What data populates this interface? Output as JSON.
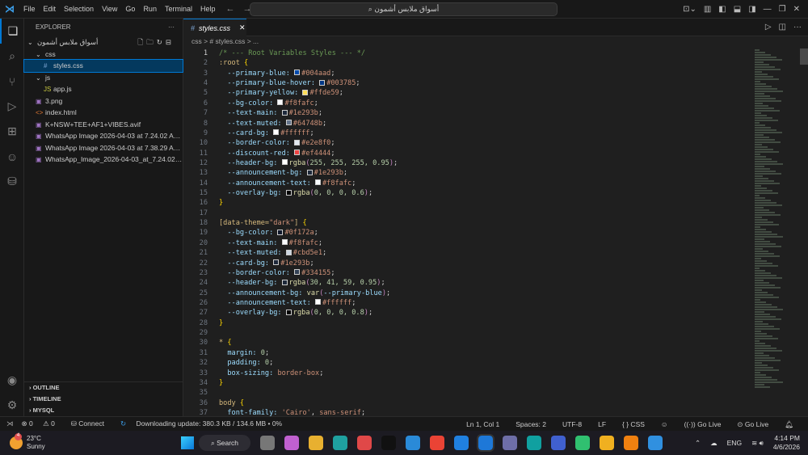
{
  "menu": [
    "File",
    "Edit",
    "Selection",
    "View",
    "Go",
    "Run",
    "Terminal",
    "Help"
  ],
  "search_text": "أسواق ملابس أشمون",
  "explorer": {
    "title": "EXPLORER",
    "root": "أسواق ملابس أشمون",
    "items": [
      {
        "label": "css",
        "icon": "⌄",
        "indent": 1,
        "sel": false
      },
      {
        "label": "styles.css",
        "icon": "#",
        "indent": 2,
        "sel": true
      },
      {
        "label": "js",
        "icon": "⌄",
        "indent": 1,
        "sel": false
      },
      {
        "label": "app.js",
        "icon": "JS",
        "indent": 2,
        "sel": false
      },
      {
        "label": "3.png",
        "icon": "▣",
        "indent": 1,
        "sel": false
      },
      {
        "label": "index.html",
        "icon": "<>",
        "indent": 1,
        "sel": false
      },
      {
        "label": "K+NSW+TEE+AF1+VIBES.avif",
        "icon": "▣",
        "indent": 1,
        "sel": false
      },
      {
        "label": "WhatsApp Image 2026-04-03 at 7.24.02 AM.jpeg",
        "icon": "▣",
        "indent": 1,
        "sel": false
      },
      {
        "label": "WhatsApp Image 2026-04-03 at 7.38.29 AM.jpeg",
        "icon": "▣",
        "indent": 1,
        "sel": false
      },
      {
        "label": "WhatsApp_Image_2026-04-03_at_7.24.02_AM.jpeg",
        "icon": "▣",
        "indent": 1,
        "sel": false
      }
    ],
    "panels": [
      "OUTLINE",
      "TIMELINE",
      "MYSQL"
    ]
  },
  "tab": {
    "label": "styles.css"
  },
  "breadcrumb": "css  >  #  styles.css  >  ...",
  "code": [
    [
      [
        "/* --- Root Variables Styles --- */",
        "c"
      ]
    ],
    [
      [
        ":root ",
        "s"
      ],
      [
        "{",
        "b"
      ]
    ],
    [
      [
        "  --primary-blue: ",
        "p"
      ],
      [
        "#004aad",
        "sw"
      ],
      [
        "#004aad",
        "v"
      ],
      [
        ";",
        "t"
      ]
    ],
    [
      [
        "  --primary-blue-hover: ",
        "p"
      ],
      [
        "#003785",
        "sw"
      ],
      [
        "#003785",
        "v"
      ],
      [
        ";",
        "t"
      ]
    ],
    [
      [
        "  --primary-yellow: ",
        "p"
      ],
      [
        "#ffde59",
        "sw"
      ],
      [
        "#ffde59",
        "v"
      ],
      [
        ";",
        "t"
      ]
    ],
    [
      [
        "  --bg-color: ",
        "p"
      ],
      [
        "#f8fafc",
        "sw"
      ],
      [
        "#f8fafc",
        "v"
      ],
      [
        ";",
        "t"
      ]
    ],
    [
      [
        "  --text-main: ",
        "p"
      ],
      [
        "#1e293b",
        "sw"
      ],
      [
        "#1e293b",
        "v"
      ],
      [
        ";",
        "t"
      ]
    ],
    [
      [
        "  --text-muted: ",
        "p"
      ],
      [
        "#64748b",
        "sw"
      ],
      [
        "#64748b",
        "v"
      ],
      [
        ";",
        "t"
      ]
    ],
    [
      [
        "  --card-bg: ",
        "p"
      ],
      [
        "#ffffff",
        "sw"
      ],
      [
        "#ffffff",
        "v"
      ],
      [
        ";",
        "t"
      ]
    ],
    [
      [
        "  --border-color: ",
        "p"
      ],
      [
        "#e2e8f0",
        "sw"
      ],
      [
        "#e2e8f0",
        "v"
      ],
      [
        ";",
        "t"
      ]
    ],
    [
      [
        "  --discount-red: ",
        "p"
      ],
      [
        "#ef4444",
        "sw"
      ],
      [
        "#ef4444",
        "v"
      ],
      [
        ";",
        "t"
      ]
    ],
    [
      [
        "  --header-bg: ",
        "p"
      ],
      [
        "#ffffff",
        "sw"
      ],
      [
        "rgba",
        "f"
      ],
      [
        "(",
        "m"
      ],
      [
        "255, 255, 255, 0.95",
        "n"
      ],
      [
        ")",
        "m"
      ],
      [
        ";",
        "t"
      ]
    ],
    [
      [
        "  --announcement-bg: ",
        "p"
      ],
      [
        "#1e293b",
        "sw"
      ],
      [
        "#1e293b",
        "v"
      ],
      [
        ";",
        "t"
      ]
    ],
    [
      [
        "  --announcement-text: ",
        "p"
      ],
      [
        "#f8fafc",
        "sw"
      ],
      [
        "#f8fafc",
        "v"
      ],
      [
        ";",
        "t"
      ]
    ],
    [
      [
        "  --overlay-bg: ",
        "p"
      ],
      [
        "#000000",
        "sw"
      ],
      [
        "rgba",
        "f"
      ],
      [
        "(",
        "m"
      ],
      [
        "0, 0, 0, 0.6",
        "n"
      ],
      [
        ")",
        "m"
      ],
      [
        ";",
        "t"
      ]
    ],
    [
      [
        "}",
        "b"
      ]
    ],
    [
      [
        "",
        "t"
      ]
    ],
    [
      [
        "[data-theme=",
        "s"
      ],
      [
        "\"dark\"",
        "q"
      ],
      [
        "] ",
        "s"
      ],
      [
        "{",
        "b"
      ]
    ],
    [
      [
        "  --bg-color: ",
        "p"
      ],
      [
        "#0f172a",
        "sw"
      ],
      [
        "#0f172a",
        "v"
      ],
      [
        ";",
        "t"
      ]
    ],
    [
      [
        "  --text-main: ",
        "p"
      ],
      [
        "#f8fafc",
        "sw"
      ],
      [
        "#f8fafc",
        "v"
      ],
      [
        ";",
        "t"
      ]
    ],
    [
      [
        "  --text-muted: ",
        "p"
      ],
      [
        "#cbd5e1",
        "sw"
      ],
      [
        "#cbd5e1",
        "v"
      ],
      [
        ";",
        "t"
      ]
    ],
    [
      [
        "  --card-bg: ",
        "p"
      ],
      [
        "#1e293b",
        "sw"
      ],
      [
        "#1e293b",
        "v"
      ],
      [
        ";",
        "t"
      ]
    ],
    [
      [
        "  --border-color: ",
        "p"
      ],
      [
        "#334155",
        "sw"
      ],
      [
        "#334155",
        "v"
      ],
      [
        ";",
        "t"
      ]
    ],
    [
      [
        "  --header-bg: ",
        "p"
      ],
      [
        "#1e293b",
        "sw"
      ],
      [
        "rgba",
        "f"
      ],
      [
        "(",
        "m"
      ],
      [
        "30, 41, 59, 0.95",
        "n"
      ],
      [
        ")",
        "m"
      ],
      [
        ";",
        "t"
      ]
    ],
    [
      [
        "  --announcement-bg: ",
        "p"
      ],
      [
        "var",
        "f"
      ],
      [
        "(",
        "m"
      ],
      [
        "--primary-blue",
        "p"
      ],
      [
        ")",
        "m"
      ],
      [
        ";",
        "t"
      ]
    ],
    [
      [
        "  --announcement-text: ",
        "p"
      ],
      [
        "#ffffff",
        "sw"
      ],
      [
        "#ffffff",
        "v"
      ],
      [
        ";",
        "t"
      ]
    ],
    [
      [
        "  --overlay-bg: ",
        "p"
      ],
      [
        "#000000",
        "sw"
      ],
      [
        "rgba",
        "f"
      ],
      [
        "(",
        "m"
      ],
      [
        "0, 0, 0, 0.8",
        "n"
      ],
      [
        ")",
        "m"
      ],
      [
        ";",
        "t"
      ]
    ],
    [
      [
        "}",
        "b"
      ]
    ],
    [
      [
        "",
        "t"
      ]
    ],
    [
      [
        "* ",
        "s"
      ],
      [
        "{",
        "b"
      ]
    ],
    [
      [
        "  margin: ",
        "p"
      ],
      [
        "0",
        "n"
      ],
      [
        ";",
        "t"
      ]
    ],
    [
      [
        "  padding: ",
        "p"
      ],
      [
        "0",
        "n"
      ],
      [
        ";",
        "t"
      ]
    ],
    [
      [
        "  box-sizing: ",
        "p"
      ],
      [
        "border-box",
        "v"
      ],
      [
        ";",
        "t"
      ]
    ],
    [
      [
        "}",
        "b"
      ]
    ],
    [
      [
        "",
        "t"
      ]
    ],
    [
      [
        "body ",
        "s"
      ],
      [
        "{",
        "b"
      ]
    ],
    [
      [
        "  font-family: ",
        "p"
      ],
      [
        "'Cairo'",
        "v"
      ],
      [
        ", ",
        "t"
      ],
      [
        "sans-serif",
        "v"
      ],
      [
        ";",
        "t"
      ]
    ]
  ],
  "status": {
    "errors": "0",
    "warnings": "0",
    "connect": "Connect",
    "download": "Downloading update: 380.3 KB / 134.6 MB • 0%",
    "position": "Ln 1, Col 1",
    "spaces": "Spaces: 2",
    "encoding": "UTF-8",
    "eol": "LF",
    "language": "{ }  CSS",
    "golive1": "((·)) Go Live",
    "golive2": "⊙ Go Live"
  },
  "taskbar": {
    "weather_temp": "23°C",
    "weather_desc": "Sunny",
    "weather_badge": "4",
    "search": "Search",
    "lang": "ENG",
    "time": "4:14 PM",
    "date": "4/6/2026",
    "apps": [
      "#777777",
      "#c060d0",
      "#e8b030",
      "#1fa0a0",
      "#e04848",
      "#111111",
      "#2a8ad8",
      "#ea4335",
      "#2080e0",
      "#1e78d8",
      "#6e6ea8",
      "#10a0a0",
      "#4060d0",
      "#30c070",
      "#f0b020",
      "#f08010",
      "#3090e0"
    ]
  }
}
